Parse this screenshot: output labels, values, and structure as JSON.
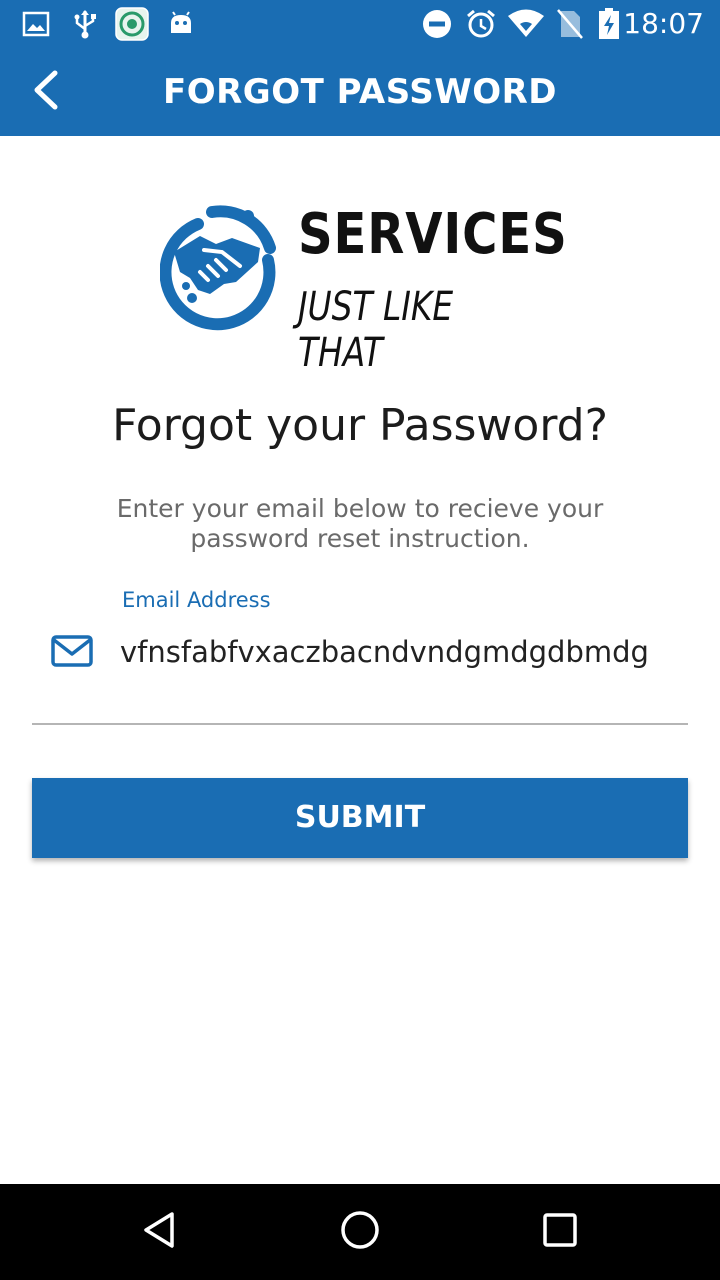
{
  "status_bar": {
    "time": "18:07",
    "icons": [
      "image-icon",
      "usb-icon",
      "app-notification-icon",
      "android-icon",
      "do-not-disturb-icon",
      "alarm-icon",
      "wifi-icon",
      "no-sim-icon",
      "battery-charging-icon"
    ]
  },
  "app_bar": {
    "title": "FORGOT PASSWORD",
    "back_icon": "chevron-left-icon"
  },
  "logo": {
    "name": "SERVICES",
    "tagline": "JUST LIKE THAT",
    "icon": "handshake-icon"
  },
  "main": {
    "heading": "Forgot your Password?",
    "subtext": "Enter your email below to recieve your password reset instruction.",
    "email_field": {
      "label": "Email Address",
      "value": "vfnsfabfvxaczbacndvndgmdgdbmdg",
      "icon": "mail-icon"
    },
    "submit_label": "SUBMIT"
  },
  "nav_bar": {
    "icons": [
      "back-triangle-icon",
      "home-circle-icon",
      "recents-square-icon"
    ]
  },
  "colors": {
    "primary": "#1a6db3",
    "text_dark": "#1c1c1c",
    "text_muted": "#6a6a6a",
    "divider": "#b5b5b5"
  }
}
